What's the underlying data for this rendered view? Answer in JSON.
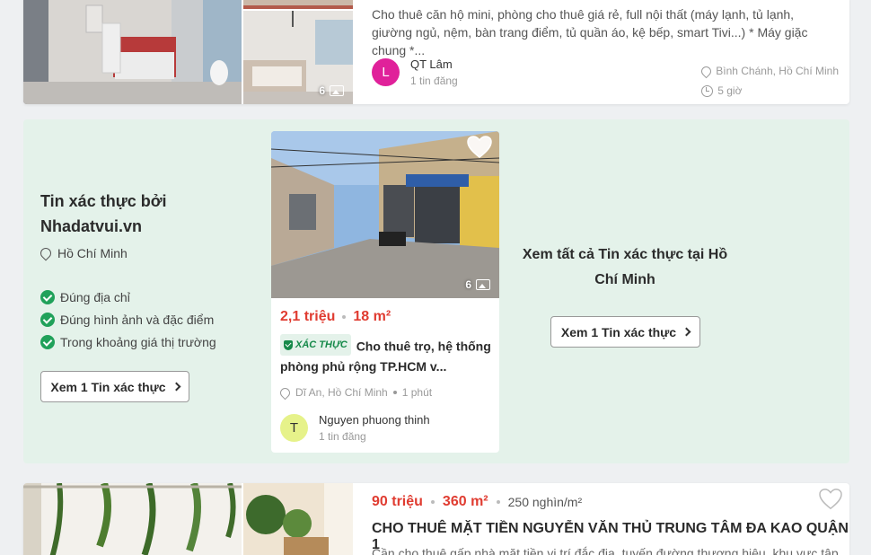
{
  "listing_top": {
    "description": "Cho thuê căn hộ mini, phòng cho thuê giá rẻ, full nội thất (máy lạnh, tủ lạnh, giường ngủ, nệm, bàn trang điểm, tủ quần áo, kệ bếp, smart Tivi...) * Máy giặc chung *...",
    "photo_count": "6",
    "poster_initial": "L",
    "poster_name": "QT Lâm",
    "poster_listings": "1 tin đăng",
    "location": "Bình Chánh, Hồ Chí Minh",
    "time": "5 giờ"
  },
  "verified": {
    "title": "Tin xác thực bởi Nhadatvui.vn",
    "location": "Hồ Chí Minh",
    "checks": [
      "Đúng địa chỉ",
      "Đúng hình ảnh và đặc điểm",
      "Trong khoảng giá thị trường"
    ],
    "button_label": "Xem 1 Tin xác thực",
    "card": {
      "photo_count": "6",
      "price": "2,1 triệu",
      "area": "18 m²",
      "badge": "XÁC THỰC",
      "title": "Cho thuê trọ, hệ thống phòng phủ rộng TP.HCM v...",
      "location": "Dĩ An, Hồ Chí Minh",
      "time": "1 phút",
      "poster_initial": "T",
      "poster_name": "Nguyen phuong thinh",
      "poster_listings": "1 tin đăng"
    },
    "see_all_text": "Xem tất cả Tin xác thực tại Hồ Chí Minh",
    "see_all_button": "Xem 1 Tin xác thực"
  },
  "listing_bottom": {
    "price": "90 triệu",
    "area": "360 m²",
    "price_per_m2": "250 nghìn/m²",
    "title": "CHO THUÊ MẶT TIỀN NGUYỄN VĂN THỦ TRUNG TÂM ĐA KAO QUẬN 1",
    "description": "Cần cho thuê gấp nhà mặt tiền vị trí đắc địa, tuyến đường thương hiệu, khu vực tập"
  },
  "colors": {
    "price": "#e03c31",
    "verified_bg": "#e4f2ea",
    "check": "#20a15a",
    "avatar_l": "#e0219a",
    "avatar_t": "#e6f28a"
  },
  "icons": [
    "image-icon",
    "pin-icon",
    "clock-icon",
    "check-circle-icon",
    "heart-icon",
    "chevron-right-icon",
    "shield-check-icon"
  ]
}
